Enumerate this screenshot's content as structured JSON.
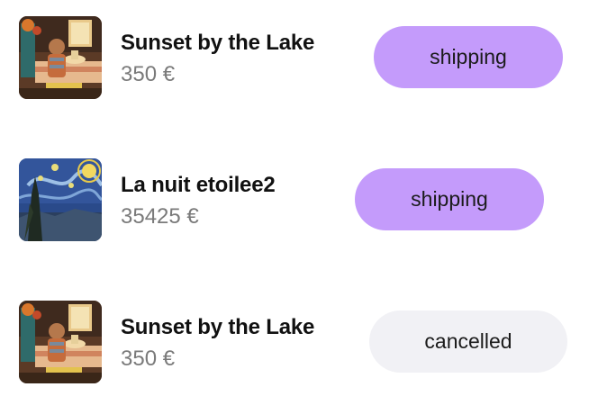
{
  "orders": [
    {
      "title": "Sunset by the Lake",
      "price": "350 €",
      "status": "shipping",
      "thumbnail_icon": "painting-girl-table-thumbnail"
    },
    {
      "title": "La nuit etoilee2",
      "price": "35425 €",
      "status": "shipping",
      "thumbnail_icon": "starry-night-thumbnail"
    },
    {
      "title": "Sunset by the Lake",
      "price": "350 €",
      "status": "cancelled",
      "thumbnail_icon": "painting-girl-table-thumbnail"
    }
  ],
  "colors": {
    "shipping_badge": "#c49bfb",
    "cancelled_badge": "#f1f1f5",
    "title_text": "#111111",
    "price_text": "#7a7a7a"
  }
}
